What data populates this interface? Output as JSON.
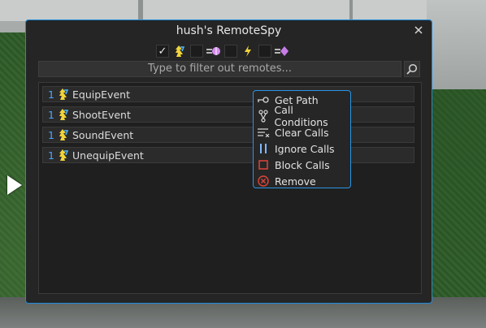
{
  "window": {
    "title": "hush's RemoteSpy",
    "search_placeholder": "Type to filter out remotes...",
    "toggles": [
      {
        "checked": true,
        "check_glyph": "✓",
        "icon": "remote-event-icon"
      },
      {
        "checked": false,
        "icon": "bindable-event-icon"
      },
      {
        "checked": false,
        "icon": "remote-function-icon"
      },
      {
        "checked": false,
        "icon": "bindable-function-icon"
      }
    ]
  },
  "remotes": [
    {
      "count": "1",
      "name": "EquipEvent"
    },
    {
      "count": "1",
      "name": "ShootEvent"
    },
    {
      "count": "1",
      "name": "SoundEvent"
    },
    {
      "count": "1",
      "name": "UnequipEvent"
    }
  ],
  "context_menu": {
    "items": [
      {
        "label": "Get Path",
        "icon": "path-key-icon"
      },
      {
        "label": "Call Conditions",
        "icon": "branch-icon"
      },
      {
        "label": "Clear Calls",
        "icon": "clear-list-icon"
      },
      {
        "label": "Ignore Calls",
        "icon": "pause-icon"
      },
      {
        "label": "Block Calls",
        "icon": "block-square-icon"
      },
      {
        "label": "Remove",
        "icon": "remove-x-icon"
      }
    ]
  },
  "colors": {
    "accent": "#1f8ad8",
    "count": "#4aa6ff",
    "remove_red": "#e0443a",
    "block_red": "#e0443a"
  }
}
